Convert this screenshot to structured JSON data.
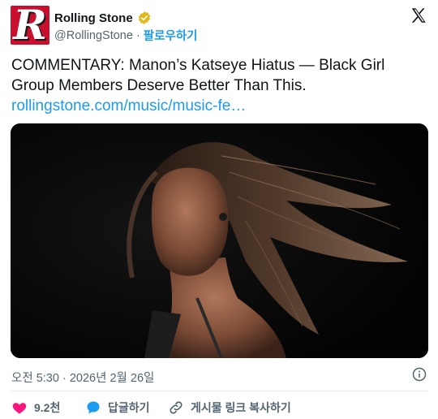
{
  "author": {
    "avatar_letter": "R",
    "name": "Rolling Stone",
    "handle": "@RollingStone",
    "separator": "·",
    "follow_label": "팔로우하기",
    "verified_icon": "verified-badge-icon",
    "brand_color": "#c8102e"
  },
  "tweet": {
    "text": "COMMENTARY: Manon’s Katseye Hiatus — Black Girl Group Members Deserve Better Than This.",
    "link": "rollingstone.com/music/music-fe…"
  },
  "timestamp": "오전 5:30 · 2026년 2월 26일",
  "actions": {
    "like_count": "9.2천",
    "reply_label": "답글하기",
    "copy_label": "게시물 링크 복사하기"
  },
  "colors": {
    "link": "#1d9bf0",
    "like": "#f91880",
    "muted": "#536471",
    "text": "#0f1419"
  }
}
